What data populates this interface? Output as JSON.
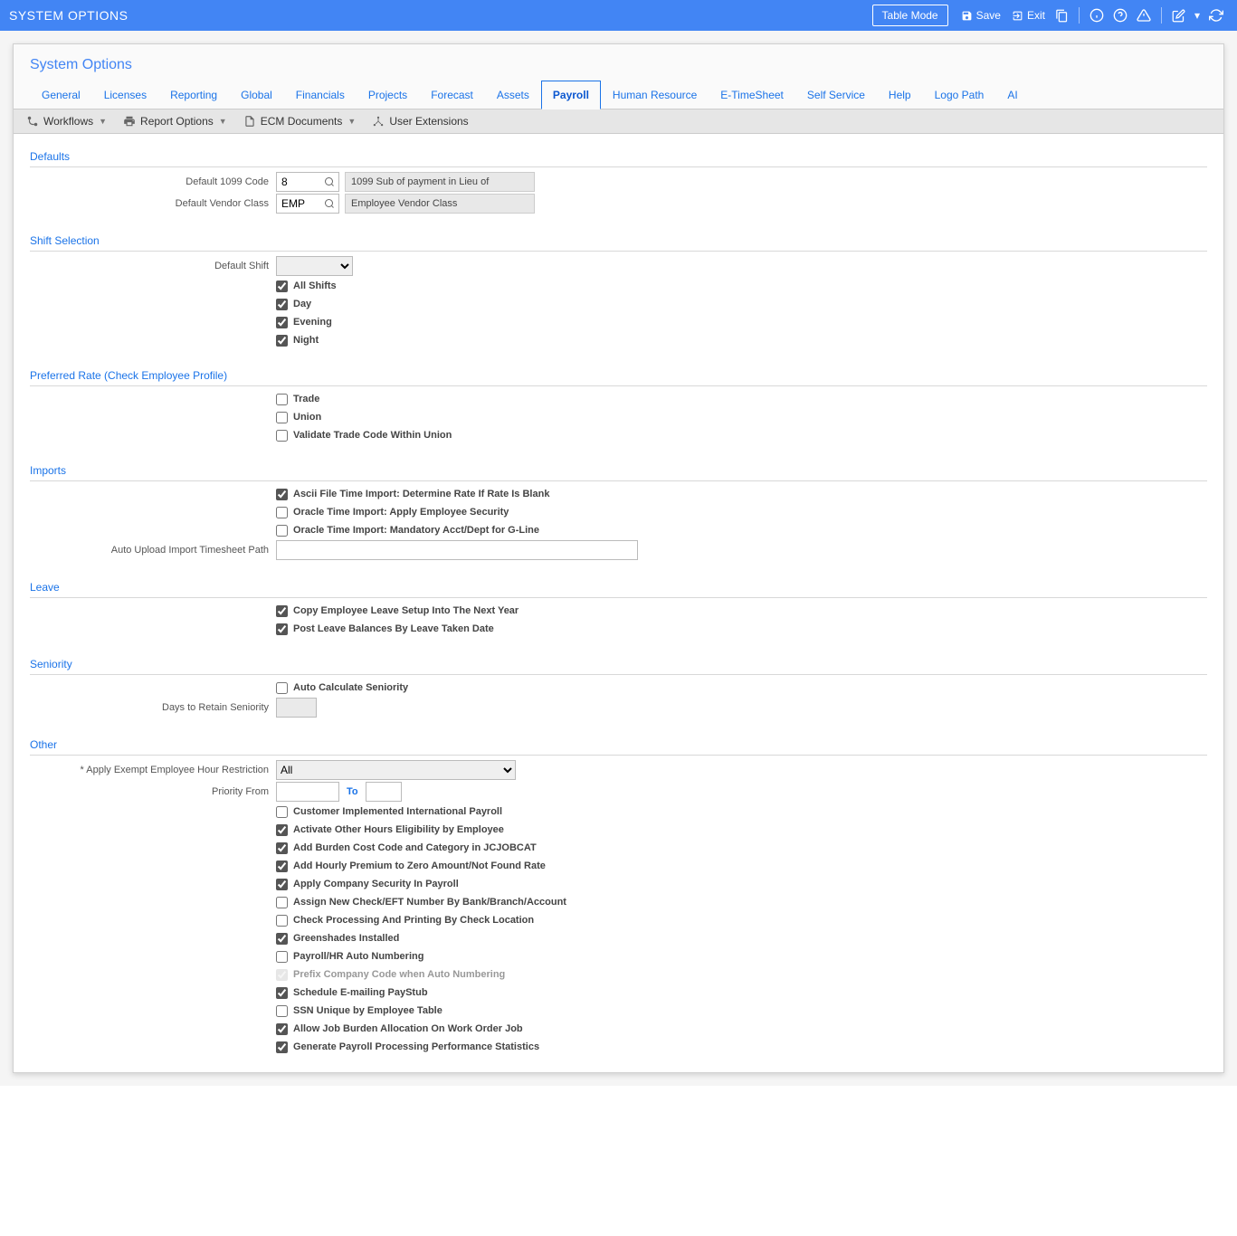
{
  "topbar": {
    "title": "SYSTEM OPTIONS",
    "table_mode": "Table Mode",
    "save": "Save",
    "exit": "Exit"
  },
  "panel_title": "System Options",
  "tabs": [
    "General",
    "Licenses",
    "Reporting",
    "Global",
    "Financials",
    "Projects",
    "Forecast",
    "Assets",
    "Payroll",
    "Human Resource",
    "E-TimeSheet",
    "Self Service",
    "Help",
    "Logo Path",
    "AI"
  ],
  "active_tab": "Payroll",
  "toolbar": {
    "workflows": "Workflows",
    "report_options": "Report Options",
    "ecm_documents": "ECM Documents",
    "user_extensions": "User Extensions"
  },
  "sections": {
    "defaults": {
      "title": "Defaults",
      "default_1099_label": "Default 1099 Code",
      "default_1099_value": "8",
      "default_1099_desc": "1099 Sub of payment in Lieu of",
      "default_vendor_label": "Default Vendor Class",
      "default_vendor_value": "EMP",
      "default_vendor_desc": "Employee Vendor Class"
    },
    "shift": {
      "title": "Shift Selection",
      "default_shift_label": "Default Shift",
      "checks": [
        {
          "label": "All Shifts",
          "checked": true
        },
        {
          "label": "Day",
          "checked": true
        },
        {
          "label": "Evening",
          "checked": true
        },
        {
          "label": "Night",
          "checked": true
        }
      ]
    },
    "preferred": {
      "title": "Preferred Rate (Check Employee Profile)",
      "checks": [
        {
          "label": "Trade",
          "checked": false
        },
        {
          "label": "Union",
          "checked": false
        },
        {
          "label": "Validate Trade Code Within Union",
          "checked": false
        }
      ]
    },
    "imports": {
      "title": "Imports",
      "checks": [
        {
          "label": "Ascii File Time Import: Determine Rate If Rate Is Blank",
          "checked": true
        },
        {
          "label": "Oracle Time Import: Apply Employee Security",
          "checked": false
        },
        {
          "label": "Oracle Time Import: Mandatory Acct/Dept for G-Line",
          "checked": false
        }
      ],
      "auto_upload_label": "Auto Upload Import Timesheet Path",
      "auto_upload_value": ""
    },
    "leave": {
      "title": "Leave",
      "checks": [
        {
          "label": "Copy Employee Leave Setup Into The Next Year",
          "checked": true
        },
        {
          "label": "Post Leave Balances By Leave Taken Date",
          "checked": true
        }
      ]
    },
    "seniority": {
      "title": "Seniority",
      "auto_calc_label": "Auto Calculate Seniority",
      "auto_calc_checked": false,
      "days_label": "Days to Retain Seniority",
      "days_value": ""
    },
    "other": {
      "title": "Other",
      "apply_exempt_label": "* Apply Exempt Employee Hour Restriction",
      "apply_exempt_value": "All",
      "priority_label": "Priority From",
      "to_label": "To",
      "checks": [
        {
          "label": "Customer Implemented International Payroll",
          "checked": false
        },
        {
          "label": "Activate Other Hours Eligibility by Employee",
          "checked": true
        },
        {
          "label": "Add Burden Cost Code and Category in JCJOBCAT",
          "checked": true
        },
        {
          "label": "Add Hourly Premium to Zero Amount/Not Found Rate",
          "checked": true
        },
        {
          "label": "Apply Company Security In Payroll",
          "checked": true
        },
        {
          "label": "Assign New Check/EFT Number By Bank/Branch/Account",
          "checked": false
        },
        {
          "label": "Check Processing And Printing By Check Location",
          "checked": false
        },
        {
          "label": "Greenshades Installed",
          "checked": true
        },
        {
          "label": "Payroll/HR Auto Numbering",
          "checked": false
        },
        {
          "label": "Prefix Company Code when Auto Numbering",
          "checked": true,
          "disabled": true
        },
        {
          "label": "Schedule E-mailing PayStub",
          "checked": true
        },
        {
          "label": "SSN Unique by Employee Table",
          "checked": false
        },
        {
          "label": "Allow Job Burden Allocation On Work Order Job",
          "checked": true
        },
        {
          "label": "Generate Payroll Processing Performance Statistics",
          "checked": true
        }
      ]
    }
  }
}
